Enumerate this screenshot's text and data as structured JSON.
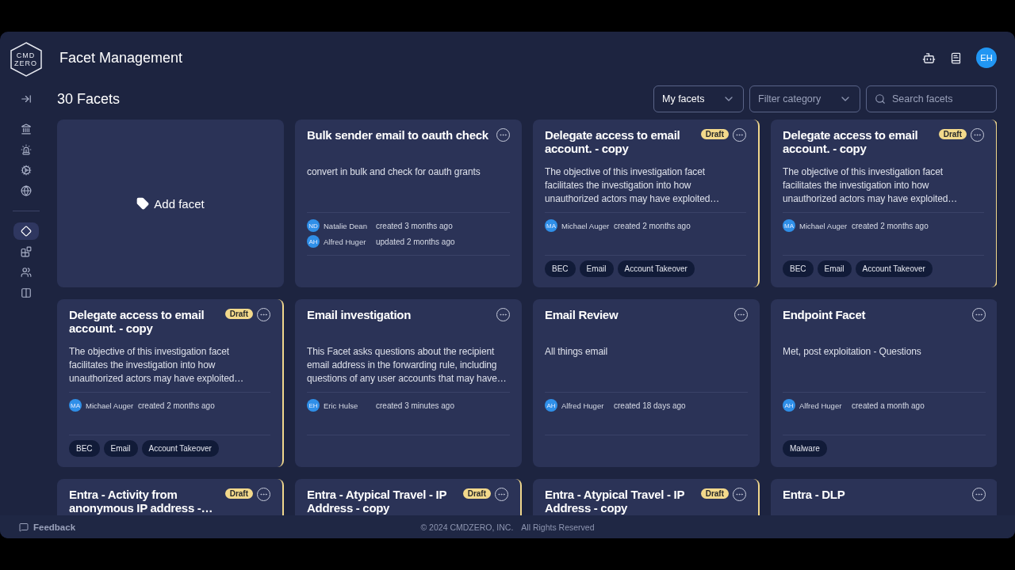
{
  "logo": {
    "line1": "CMD",
    "line2": "ZERO"
  },
  "header": {
    "title": "Facet Management",
    "avatar": "EH"
  },
  "sidebar": {
    "groups": [
      [
        {
          "selected": false
        },
        {
          "selected": false
        },
        {
          "selected": false
        },
        {
          "selected": false
        }
      ],
      [
        {
          "selected": true
        },
        {
          "selected": false
        },
        {
          "selected": false
        },
        {
          "selected": false
        }
      ]
    ]
  },
  "toolbar": {
    "count": "30 Facets",
    "filters": [
      {
        "kind": "select",
        "value": "My facets"
      },
      {
        "kind": "select",
        "placeholder": "Filter category"
      },
      {
        "kind": "search",
        "placeholder": "Search facets"
      }
    ]
  },
  "cards": [
    {
      "kind": "add",
      "label": "Add facet"
    },
    {
      "kind": "facet",
      "title": "Bulk sender email to oauth check",
      "draft": false,
      "description": "convert in bulk and check for oauth grants",
      "authors": [
        {
          "initials": "ND",
          "name": "Natalie Dean",
          "action": "created 3 months ago"
        },
        {
          "initials": "AH",
          "name": "Alfred Huger",
          "action": "updated 2 months ago"
        }
      ]
    },
    {
      "kind": "facet",
      "title": "Delegate access to email account. - copy",
      "draft": true,
      "badge": "Draft",
      "description": "The objective of this investigation facet facilitates the investigation into how unauthorized actors may have exploited…",
      "authors": [
        {
          "initials": "MA",
          "name": "Michael Auger",
          "action": "created 2 months ago"
        }
      ],
      "tags": [
        "BEC",
        "Email",
        "Account Takeover"
      ]
    },
    {
      "kind": "facet",
      "title": "Delegate access to email account. - copy",
      "draft": true,
      "badge": "Draft",
      "description": "The objective of this investigation facet facilitates the investigation into how unauthorized actors may have exploited…",
      "authors": [
        {
          "initials": "MA",
          "name": "Michael Auger",
          "action": "created 2 months ago"
        }
      ],
      "tags": [
        "BEC",
        "Email",
        "Account Takeover"
      ]
    },
    {
      "kind": "facet",
      "title": "Delegate access to email account. - copy",
      "draft": true,
      "badge": "Draft",
      "description": "The objective of this investigation facet facilitates the investigation into how unauthorized actors may have exploited…",
      "authors": [
        {
          "initials": "MA",
          "name": "Michael Auger",
          "action": "created 2 months ago"
        }
      ],
      "tags": [
        "BEC",
        "Email",
        "Account Takeover"
      ]
    },
    {
      "kind": "facet",
      "title": "Email investigation",
      "draft": false,
      "description": "This Facet asks questions about the recipient email address in the forwarding rule, including questions of any user accounts that may have…",
      "authors": [
        {
          "initials": "EH",
          "name": "Eric Hulse",
          "action": "created 3 minutes ago"
        }
      ]
    },
    {
      "kind": "facet",
      "title": "Email Review",
      "draft": false,
      "description": "All things email",
      "authors": [
        {
          "initials": "AH",
          "name": "Alfred Huger",
          "action": "created 18 days ago"
        }
      ]
    },
    {
      "kind": "facet",
      "title": "Endpoint Facet",
      "draft": false,
      "description": "Met, post exploitation - Questions",
      "authors": [
        {
          "initials": "AH",
          "name": "Alfred Huger",
          "action": "created a month ago"
        }
      ],
      "tags": [
        "Malware"
      ]
    },
    {
      "kind": "facet",
      "title": "Entra - Activity from anonymous IP address -…",
      "draft": true,
      "badge": "Draft"
    },
    {
      "kind": "facet",
      "title": "Entra - Atypical Travel - IP Address - copy",
      "draft": true,
      "badge": "Draft"
    },
    {
      "kind": "facet",
      "title": "Entra - Atypical Travel - IP Address - copy",
      "draft": true,
      "badge": "Draft"
    },
    {
      "kind": "facet",
      "title": "Entra - DLP",
      "draft": false
    }
  ],
  "footer": {
    "feedback": "Feedback",
    "copyright": "© 2024 CMDZERO, INC.",
    "rights": "All Rights Reserved"
  }
}
